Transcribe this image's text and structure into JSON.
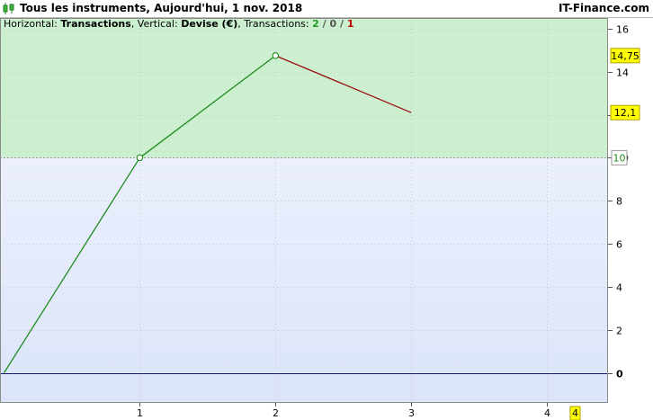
{
  "header": {
    "title": "Tous les instruments, Aujourd'hui, 1 nov. 2018",
    "brand": "IT-Finance.com"
  },
  "info": {
    "h_prefix": "Horizontal: ",
    "h_value": "Transactions",
    "v_prefix": ", Vertical: ",
    "v_value": "Devise (€)",
    "t_prefix": ", Transactions: ",
    "wins": "2",
    "sep1": " / ",
    "neutral": "0",
    "sep2": " / ",
    "losses": "1"
  },
  "colors": {
    "profit_zone": "#ccf0cf",
    "lower_zone_top": "#f4f6ff",
    "lower_zone_bottom": "#dbe4f8",
    "up_line": "#1e8c1e",
    "down_line": "#9b1010",
    "zero_line": "#1a1a6a",
    "label_bg": "#ffff00",
    "ref_label": "#1e8c1e"
  },
  "chart_data": {
    "type": "line",
    "x": [
      0,
      1,
      2,
      3
    ],
    "y": [
      0,
      10,
      14.75,
      12.1
    ],
    "xlim": [
      -0.03,
      4.45
    ],
    "ylim": [
      -1.4,
      16.5
    ],
    "x_ticks": [
      "1",
      "2",
      "3",
      "4"
    ],
    "y_ticks": [
      "0",
      "2",
      "4",
      "6",
      "8",
      "10",
      "12",
      "14",
      "16"
    ],
    "value_labels": [
      "14,75",
      "12,1"
    ],
    "reference_label": "10",
    "x_end_label": "4",
    "reference_value": 10,
    "grid": true
  }
}
